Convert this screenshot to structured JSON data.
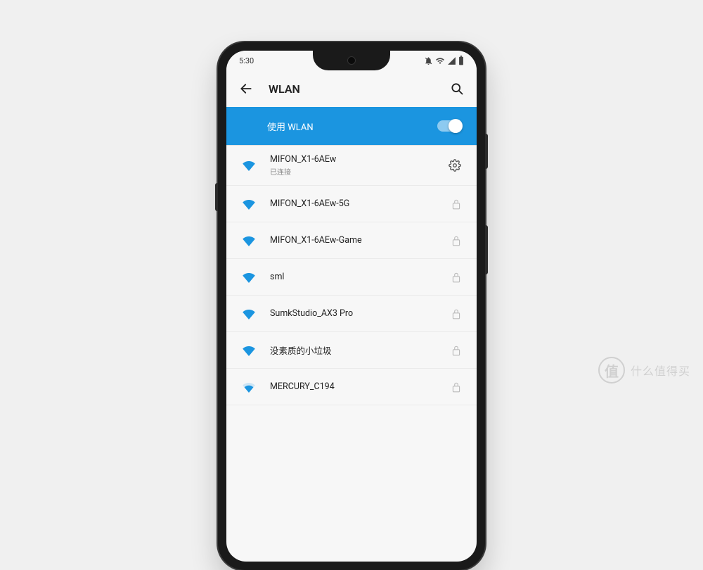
{
  "status_bar": {
    "time": "5:30"
  },
  "header": {
    "title": "WLAN"
  },
  "toggle": {
    "label": "使用 WLAN",
    "enabled": true
  },
  "networks": [
    {
      "ssid": "MIFON_X1-6AEw",
      "status": "已连接",
      "connected": true,
      "locked": false,
      "signal": 4
    },
    {
      "ssid": "MIFON_X1-6AEw-5G",
      "status": null,
      "connected": false,
      "locked": true,
      "signal": 4
    },
    {
      "ssid": "MIFON_X1-6AEw-Game",
      "status": null,
      "connected": false,
      "locked": true,
      "signal": 4
    },
    {
      "ssid": "sml",
      "status": null,
      "connected": false,
      "locked": true,
      "signal": 4
    },
    {
      "ssid": "SumkStudio_AX3 Pro",
      "status": null,
      "connected": false,
      "locked": true,
      "signal": 4
    },
    {
      "ssid": "没素质的小垃圾",
      "status": null,
      "connected": false,
      "locked": true,
      "signal": 4
    },
    {
      "ssid": "MERCURY_C194",
      "status": null,
      "connected": false,
      "locked": true,
      "signal": 3
    }
  ],
  "watermark": {
    "symbol": "值",
    "text": "什么值得买"
  },
  "colors": {
    "accent": "#1b95e0",
    "wifi": "#1b95e0"
  }
}
